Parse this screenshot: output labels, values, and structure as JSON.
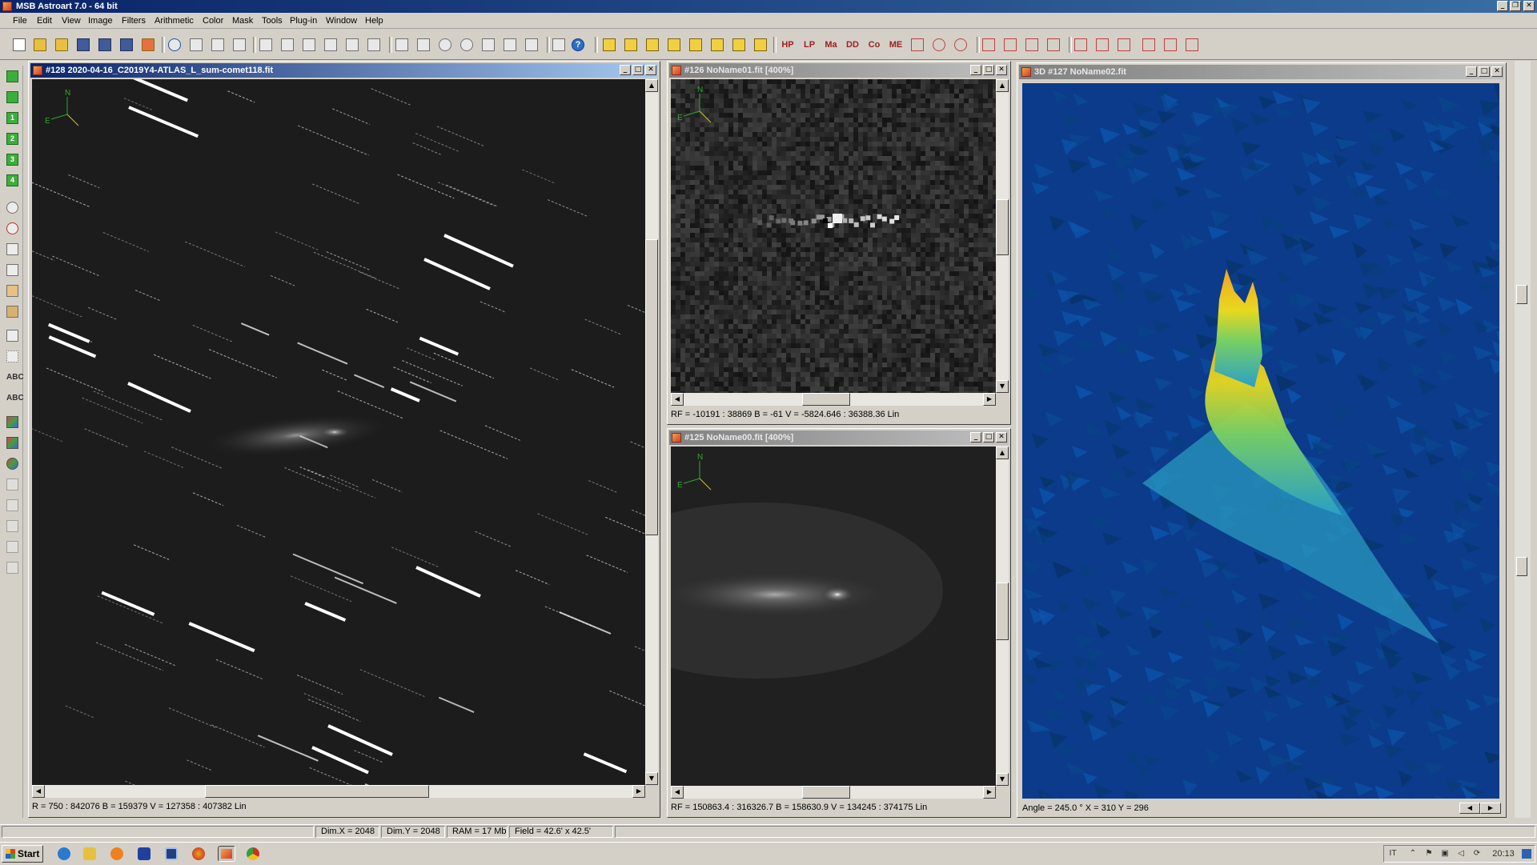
{
  "app": {
    "title": "MSB Astroart 7.0 - 64 bit"
  },
  "menu": [
    "File",
    "Edit",
    "View",
    "Image",
    "Filters",
    "Arithmetic",
    "Color",
    "Mask",
    "Tools",
    "Plug-in",
    "Window",
    "Help"
  ],
  "toolbar": {
    "text_buttons": [
      "HP",
      "LP",
      "Ma",
      "DD",
      "Co",
      "ME"
    ],
    "help_label": "?"
  },
  "lefttools": {
    "numbers": [
      "1",
      "2",
      "3",
      "4"
    ],
    "abc": "ABC"
  },
  "windows": {
    "w128": {
      "title": "#128 2020-04-16_C2019Y4-ATLAS_L_sum-comet118.fit",
      "status": "R = 750 : 842076    B = 159379    V = 127358 : 407382 Lin",
      "compass_n": "N",
      "compass_e": "E"
    },
    "w126": {
      "title": "#126 NoName01.fit  [400%]",
      "status": "RF = -10191 : 38869    B = -61    V = -5824.646 : 36388.36 Lin",
      "compass_n": "N",
      "compass_e": "E"
    },
    "w125": {
      "title": "#125 NoName00.fit  [400%]",
      "status": "RF = 150863.4 : 316326.7    B = 158630.9    V = 134245 : 374175 Lin",
      "compass_n": "N",
      "compass_e": "E"
    },
    "w127": {
      "title": "3D #127 NoName02.fit",
      "status": "Angle  =  245.0 °   X = 310  Y = 296"
    }
  },
  "statusbar": {
    "dimx": "Dim.X = 2048",
    "dimy": "Dim.Y = 2048",
    "ram": "RAM = 17 Mb",
    "field": "Field = 42.6' x 42.5'"
  },
  "taskbar": {
    "start": "Start",
    "lang": "IT",
    "clock": "20:13"
  },
  "colors": {
    "title_active": "#0a246a",
    "title_inactive": "#808080",
    "surface_low": "#0d3a86",
    "surface_high": "#f5a020"
  }
}
